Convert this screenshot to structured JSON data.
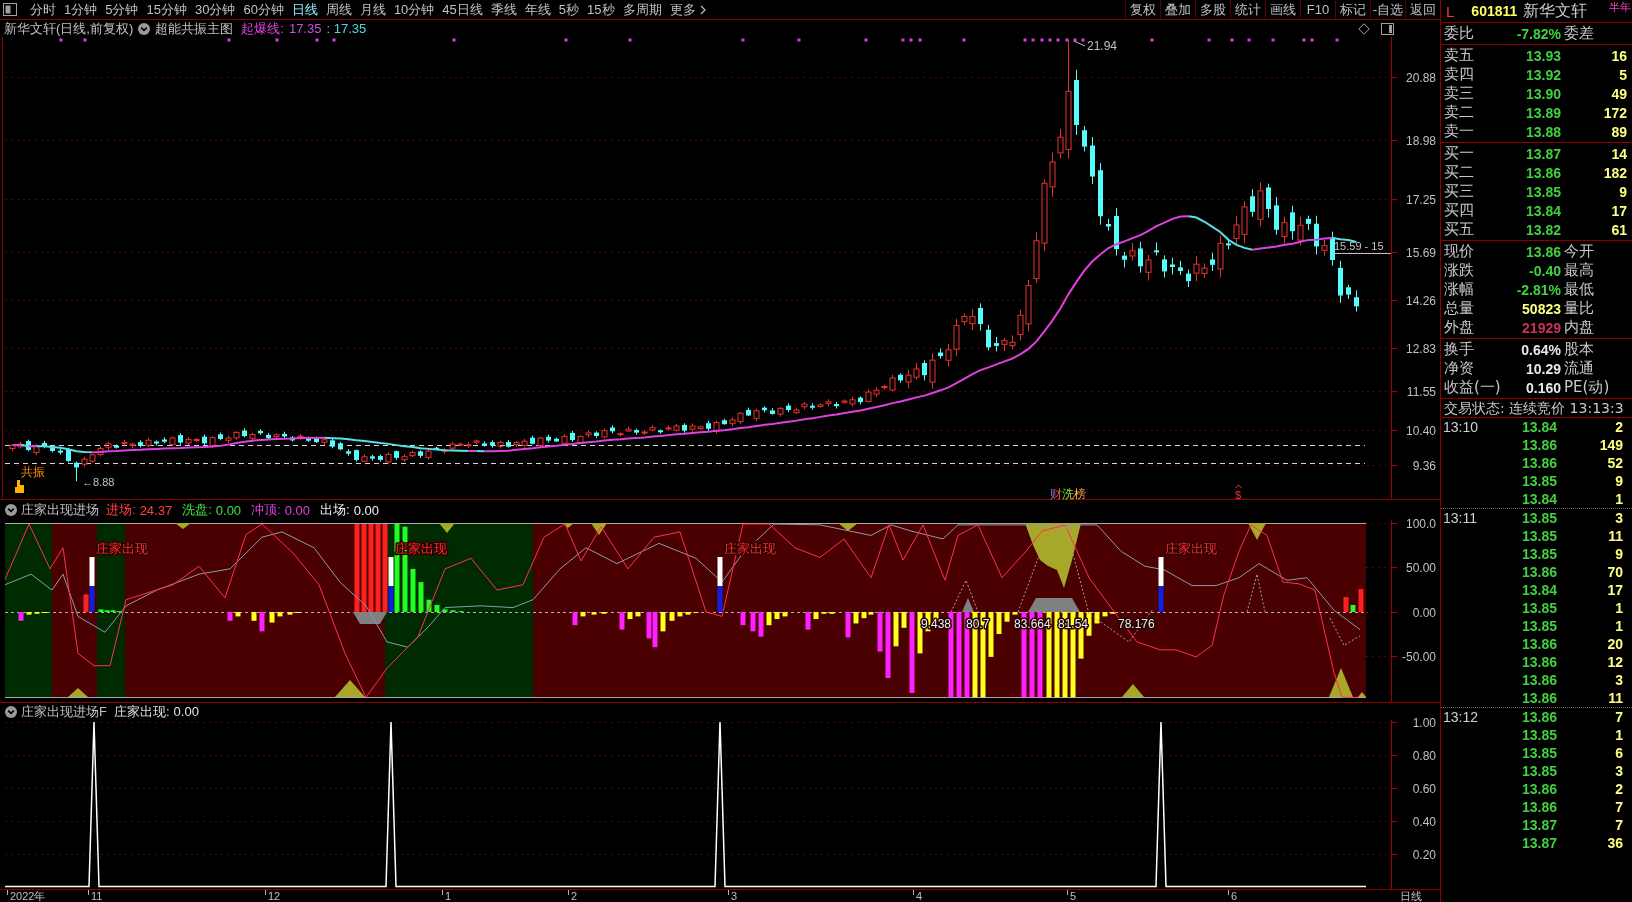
{
  "toolbar": {
    "periods": [
      {
        "label": "分时",
        "selected": false
      },
      {
        "label": "1分钟",
        "selected": false
      },
      {
        "label": "5分钟",
        "selected": false
      },
      {
        "label": "15分钟",
        "selected": false
      },
      {
        "label": "30分钟",
        "selected": false
      },
      {
        "label": "60分钟",
        "selected": false
      },
      {
        "label": "日线",
        "selected": true
      },
      {
        "label": "周线",
        "selected": false
      },
      {
        "label": "月线",
        "selected": false
      },
      {
        "label": "10分钟",
        "selected": false
      },
      {
        "label": "45日线",
        "selected": false
      },
      {
        "label": "季线",
        "selected": false
      },
      {
        "label": "年线",
        "selected": false
      },
      {
        "label": "5秒",
        "selected": false
      },
      {
        "label": "15秒",
        "selected": false
      },
      {
        "label": "多周期",
        "selected": false
      }
    ],
    "more": "更多",
    "tools": [
      "复权",
      "叠加",
      "多股",
      "统计",
      "画线",
      "F10",
      "标记",
      "-自选",
      "返回"
    ]
  },
  "main_chart": {
    "title": "新华文轩(日线,前复权)",
    "indicator": "超能共振主图",
    "line": {
      "label": "起爆线:",
      "values": [
        {
          "text": "17.35",
          "color": "#c050e0"
        },
        {
          "text": ": 17.35",
          "color": "#50d8e8"
        }
      ]
    },
    "y_axis": [
      "20.88",
      "18.98",
      "17.25",
      "15.69",
      "14.26",
      "12.83",
      "11.55",
      "10.40",
      "9.36"
    ],
    "annotations": [
      {
        "kind": "high",
        "text": "21.94"
      },
      {
        "kind": "low",
        "text": "←8.88"
      },
      {
        "kind": "level",
        "text": "15.59 - 15"
      },
      {
        "kind": "signal",
        "text": "共振"
      },
      {
        "kind": "badge",
        "text": "财洗榜"
      },
      {
        "kind": "mark",
        "text": "$"
      }
    ]
  },
  "entry_panel": {
    "title": "庄家出现进场",
    "legend": [
      {
        "label": "进场:",
        "value": "24.37",
        "color": "#ff4040"
      },
      {
        "label": "洗盘:",
        "value": "0.00",
        "color": "#40e040"
      },
      {
        "label": "冲顶:",
        "value": "0.00",
        "color": "#e040e0"
      },
      {
        "label": "出场:",
        "value": "0.00",
        "color": "#f0f0f0"
      }
    ],
    "y_axis": [
      "100.0",
      "50.00",
      "0.00",
      "-50.00"
    ],
    "signal_labels": [
      "庄家出现",
      "庄家出现",
      "庄家出现",
      "庄家出现"
    ],
    "value_labels": [
      "9.438",
      "80.7",
      "83.664",
      "81.54",
      "78.176"
    ]
  },
  "signal_panel": {
    "title": "庄家出现进场F",
    "legend": [
      {
        "label": "庄家出现:",
        "value": "0.00",
        "color": "#e0e0e0"
      }
    ],
    "y_axis": [
      "1.00",
      "0.80",
      "0.60",
      "0.40",
      "0.20"
    ]
  },
  "date_axis": {
    "labels": [
      "2022年",
      "11",
      "12",
      "1",
      "2",
      "3",
      "4",
      "5",
      "6"
    ],
    "period": "日线"
  },
  "quote": {
    "market_flag": "L",
    "code": "601811",
    "name": "新华文轩",
    "report_badge": "半年",
    "ratio": {
      "label": "委比",
      "value": "-7.82%",
      "color": "#40d040",
      "label2": "委差"
    },
    "asks": [
      {
        "label": "卖五",
        "price": "13.93",
        "volume": "16"
      },
      {
        "label": "卖四",
        "price": "13.92",
        "volume": "5"
      },
      {
        "label": "卖三",
        "price": "13.90",
        "volume": "49"
      },
      {
        "label": "卖二",
        "price": "13.89",
        "volume": "172"
      },
      {
        "label": "卖一",
        "price": "13.88",
        "volume": "89"
      }
    ],
    "bids": [
      {
        "label": "买一",
        "price": "13.87",
        "volume": "14"
      },
      {
        "label": "买二",
        "price": "13.86",
        "volume": "182"
      },
      {
        "label": "买三",
        "price": "13.85",
        "volume": "9"
      },
      {
        "label": "买四",
        "price": "13.84",
        "volume": "17"
      },
      {
        "label": "买五",
        "price": "13.82",
        "volume": "61"
      }
    ],
    "stats": [
      {
        "label": "现价",
        "value": "13.86",
        "color": "#40d040",
        "label2": "今开"
      },
      {
        "label": "涨跌",
        "value": "-0.40",
        "color": "#40d040",
        "label2": "最高"
      },
      {
        "label": "涨幅",
        "value": "-2.81%",
        "color": "#40d040",
        "label2": "最低"
      },
      {
        "label": "总量",
        "value": "50823",
        "color": "#ffff80",
        "label2": "量比"
      },
      {
        "label": "外盘",
        "value": "21929",
        "color": "#c8325a",
        "label2": "内盘"
      }
    ],
    "fundamentals": [
      {
        "label": "换手",
        "value": "0.64%",
        "label2": "股本"
      },
      {
        "label": "净资",
        "value": "10.29",
        "label2": "流通"
      },
      {
        "label": "收益(一)",
        "value": "0.160",
        "label2": "PE(动)"
      }
    ],
    "trade_status": "交易状态: 连续竞价 13:13:3",
    "ticks": [
      {
        "time": "13:10",
        "trades": [
          {
            "price": "13.84",
            "volume": "2"
          },
          {
            "price": "13.86",
            "volume": "149"
          },
          {
            "price": "13.86",
            "volume": "52"
          },
          {
            "price": "13.85",
            "volume": "9"
          },
          {
            "price": "13.84",
            "volume": "1"
          }
        ]
      },
      {
        "time": "13:11",
        "trades": [
          {
            "price": "13.85",
            "volume": "3"
          },
          {
            "price": "13.85",
            "volume": "11"
          },
          {
            "price": "13.85",
            "volume": "9"
          },
          {
            "price": "13.86",
            "volume": "70"
          },
          {
            "price": "13.84",
            "volume": "17"
          },
          {
            "price": "13.85",
            "volume": "1"
          },
          {
            "price": "13.85",
            "volume": "1"
          },
          {
            "price": "13.86",
            "volume": "20"
          },
          {
            "price": "13.86",
            "volume": "12"
          },
          {
            "price": "13.86",
            "volume": "3"
          },
          {
            "price": "13.86",
            "volume": "11"
          }
        ]
      },
      {
        "time": "13:12",
        "trades": [
          {
            "price": "13.86",
            "volume": "7"
          },
          {
            "price": "13.85",
            "volume": "1"
          },
          {
            "price": "13.85",
            "volume": "6"
          },
          {
            "price": "13.85",
            "volume": "3"
          },
          {
            "price": "13.86",
            "volume": "2"
          },
          {
            "price": "13.86",
            "volume": "7"
          },
          {
            "price": "13.87",
            "volume": "7"
          },
          {
            "price": "13.87",
            "volume": "36"
          }
        ]
      }
    ]
  }
}
